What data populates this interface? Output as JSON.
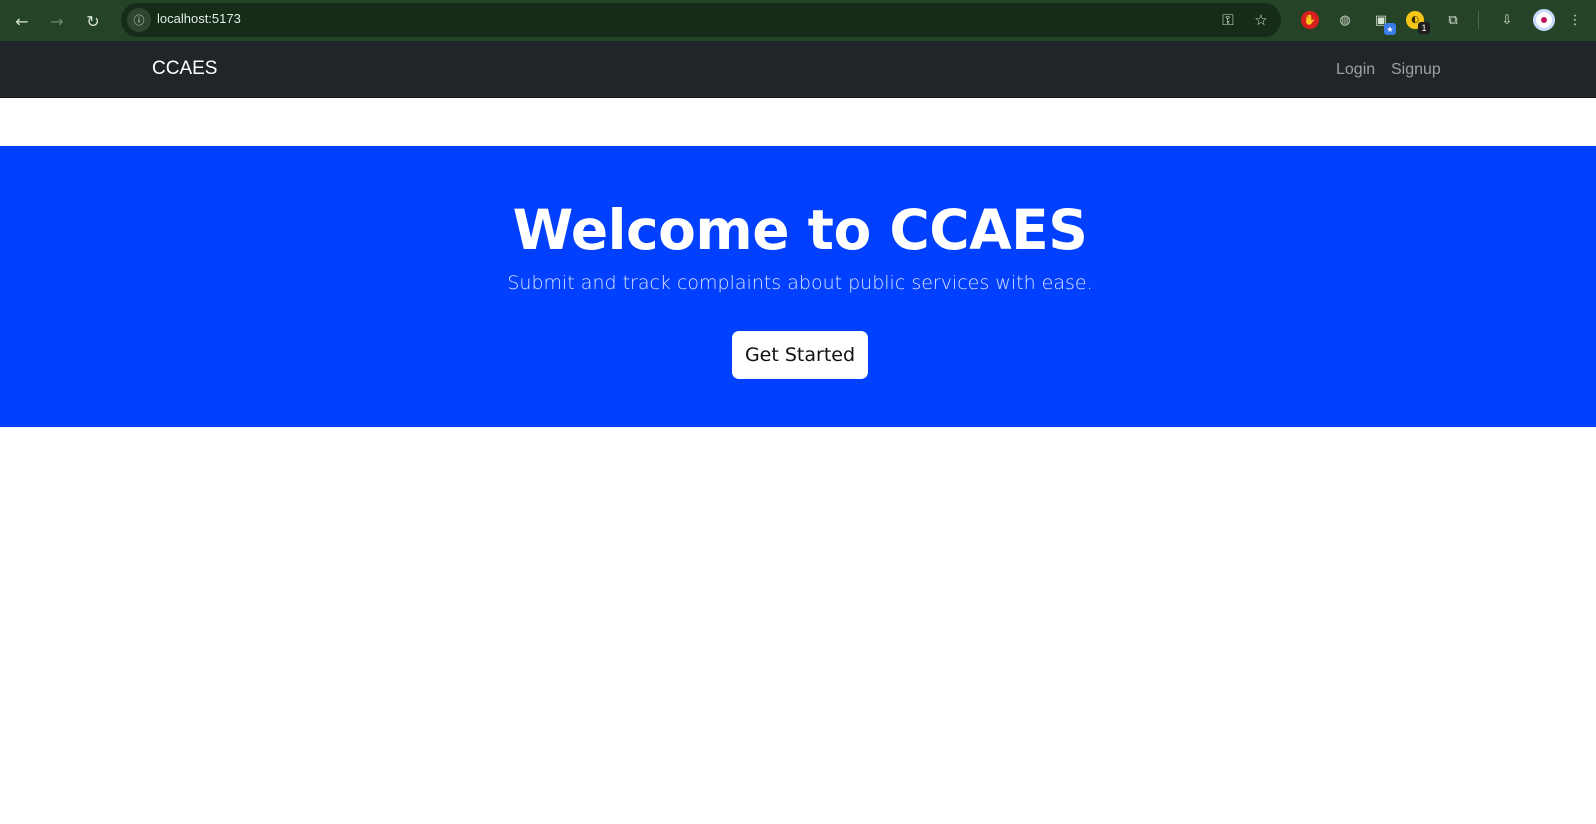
{
  "browser": {
    "url": "localhost:5173",
    "back_icon": "arrow-left-icon",
    "forward_icon": "arrow-right-icon",
    "reload_icon": "reload-icon",
    "extension_badge_count": "1"
  },
  "navbar": {
    "brand": "CCAES",
    "links": {
      "login": "Login",
      "signup": "Signup"
    }
  },
  "hero": {
    "title": "Welcome to CCAES",
    "subtitle": "Submit and track complaints about public services with ease.",
    "cta_label": "Get Started"
  },
  "colors": {
    "browser_bar": "#254326",
    "navbar": "#212529",
    "hero_bg": "#0040fe",
    "cta_bg": "#ffffff"
  }
}
